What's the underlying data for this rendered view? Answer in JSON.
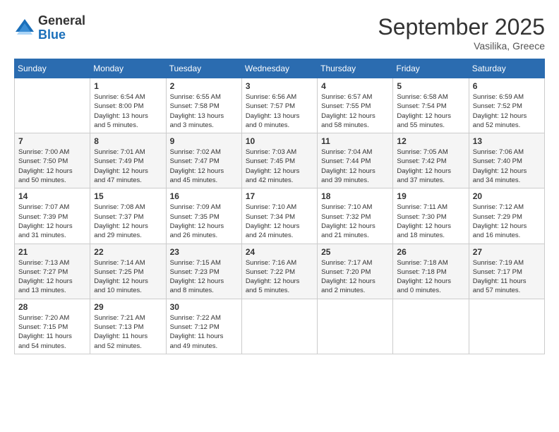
{
  "header": {
    "logo": {
      "general": "General",
      "blue": "Blue"
    },
    "title": "September 2025",
    "location": "Vasilika, Greece"
  },
  "columns": [
    "Sunday",
    "Monday",
    "Tuesday",
    "Wednesday",
    "Thursday",
    "Friday",
    "Saturday"
  ],
  "weeks": [
    [
      {
        "day": "",
        "info": ""
      },
      {
        "day": "1",
        "info": "Sunrise: 6:54 AM\nSunset: 8:00 PM\nDaylight: 13 hours\nand 5 minutes."
      },
      {
        "day": "2",
        "info": "Sunrise: 6:55 AM\nSunset: 7:58 PM\nDaylight: 13 hours\nand 3 minutes."
      },
      {
        "day": "3",
        "info": "Sunrise: 6:56 AM\nSunset: 7:57 PM\nDaylight: 13 hours\nand 0 minutes."
      },
      {
        "day": "4",
        "info": "Sunrise: 6:57 AM\nSunset: 7:55 PM\nDaylight: 12 hours\nand 58 minutes."
      },
      {
        "day": "5",
        "info": "Sunrise: 6:58 AM\nSunset: 7:54 PM\nDaylight: 12 hours\nand 55 minutes."
      },
      {
        "day": "6",
        "info": "Sunrise: 6:59 AM\nSunset: 7:52 PM\nDaylight: 12 hours\nand 52 minutes."
      }
    ],
    [
      {
        "day": "7",
        "info": "Sunrise: 7:00 AM\nSunset: 7:50 PM\nDaylight: 12 hours\nand 50 minutes."
      },
      {
        "day": "8",
        "info": "Sunrise: 7:01 AM\nSunset: 7:49 PM\nDaylight: 12 hours\nand 47 minutes."
      },
      {
        "day": "9",
        "info": "Sunrise: 7:02 AM\nSunset: 7:47 PM\nDaylight: 12 hours\nand 45 minutes."
      },
      {
        "day": "10",
        "info": "Sunrise: 7:03 AM\nSunset: 7:45 PM\nDaylight: 12 hours\nand 42 minutes."
      },
      {
        "day": "11",
        "info": "Sunrise: 7:04 AM\nSunset: 7:44 PM\nDaylight: 12 hours\nand 39 minutes."
      },
      {
        "day": "12",
        "info": "Sunrise: 7:05 AM\nSunset: 7:42 PM\nDaylight: 12 hours\nand 37 minutes."
      },
      {
        "day": "13",
        "info": "Sunrise: 7:06 AM\nSunset: 7:40 PM\nDaylight: 12 hours\nand 34 minutes."
      }
    ],
    [
      {
        "day": "14",
        "info": "Sunrise: 7:07 AM\nSunset: 7:39 PM\nDaylight: 12 hours\nand 31 minutes."
      },
      {
        "day": "15",
        "info": "Sunrise: 7:08 AM\nSunset: 7:37 PM\nDaylight: 12 hours\nand 29 minutes."
      },
      {
        "day": "16",
        "info": "Sunrise: 7:09 AM\nSunset: 7:35 PM\nDaylight: 12 hours\nand 26 minutes."
      },
      {
        "day": "17",
        "info": "Sunrise: 7:10 AM\nSunset: 7:34 PM\nDaylight: 12 hours\nand 24 minutes."
      },
      {
        "day": "18",
        "info": "Sunrise: 7:10 AM\nSunset: 7:32 PM\nDaylight: 12 hours\nand 21 minutes."
      },
      {
        "day": "19",
        "info": "Sunrise: 7:11 AM\nSunset: 7:30 PM\nDaylight: 12 hours\nand 18 minutes."
      },
      {
        "day": "20",
        "info": "Sunrise: 7:12 AM\nSunset: 7:29 PM\nDaylight: 12 hours\nand 16 minutes."
      }
    ],
    [
      {
        "day": "21",
        "info": "Sunrise: 7:13 AM\nSunset: 7:27 PM\nDaylight: 12 hours\nand 13 minutes."
      },
      {
        "day": "22",
        "info": "Sunrise: 7:14 AM\nSunset: 7:25 PM\nDaylight: 12 hours\nand 10 minutes."
      },
      {
        "day": "23",
        "info": "Sunrise: 7:15 AM\nSunset: 7:23 PM\nDaylight: 12 hours\nand 8 minutes."
      },
      {
        "day": "24",
        "info": "Sunrise: 7:16 AM\nSunset: 7:22 PM\nDaylight: 12 hours\nand 5 minutes."
      },
      {
        "day": "25",
        "info": "Sunrise: 7:17 AM\nSunset: 7:20 PM\nDaylight: 12 hours\nand 2 minutes."
      },
      {
        "day": "26",
        "info": "Sunrise: 7:18 AM\nSunset: 7:18 PM\nDaylight: 12 hours\nand 0 minutes."
      },
      {
        "day": "27",
        "info": "Sunrise: 7:19 AM\nSunset: 7:17 PM\nDaylight: 11 hours\nand 57 minutes."
      }
    ],
    [
      {
        "day": "28",
        "info": "Sunrise: 7:20 AM\nSunset: 7:15 PM\nDaylight: 11 hours\nand 54 minutes."
      },
      {
        "day": "29",
        "info": "Sunrise: 7:21 AM\nSunset: 7:13 PM\nDaylight: 11 hours\nand 52 minutes."
      },
      {
        "day": "30",
        "info": "Sunrise: 7:22 AM\nSunset: 7:12 PM\nDaylight: 11 hours\nand 49 minutes."
      },
      {
        "day": "",
        "info": ""
      },
      {
        "day": "",
        "info": ""
      },
      {
        "day": "",
        "info": ""
      },
      {
        "day": "",
        "info": ""
      }
    ]
  ]
}
